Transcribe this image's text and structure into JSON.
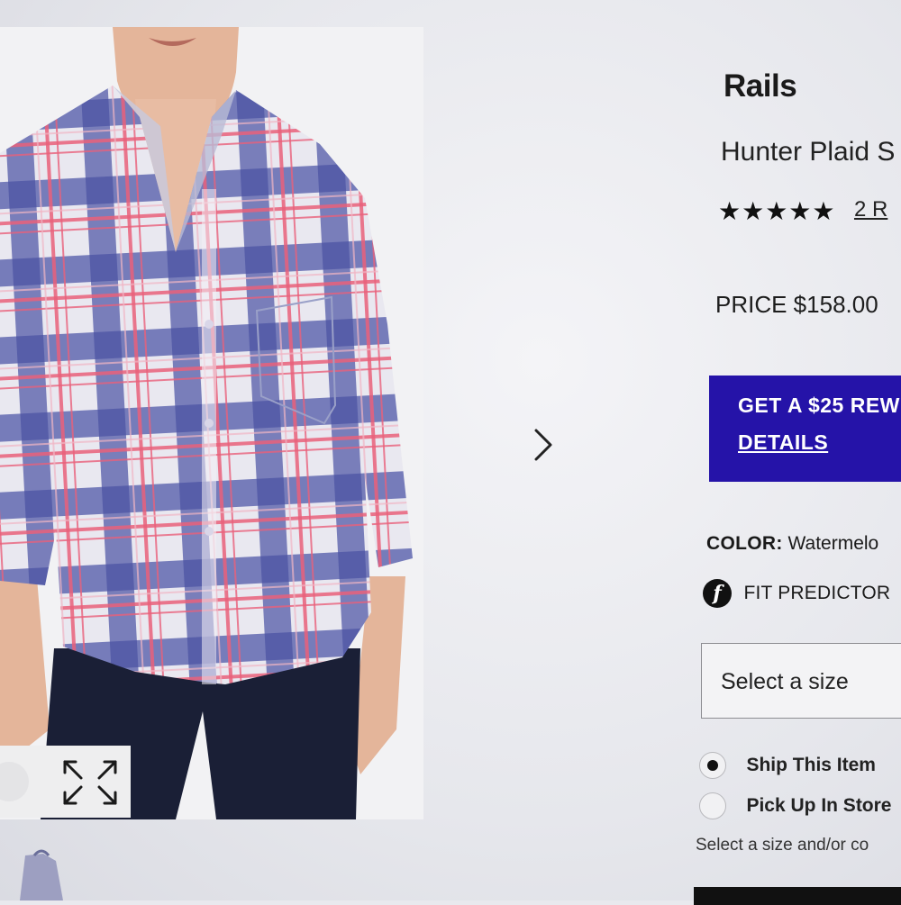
{
  "product": {
    "brand": "Rails",
    "name": "Hunter Plaid S",
    "stars": "★★★★★",
    "reviews": "2 R",
    "price": "PRICE $158.00"
  },
  "reward": {
    "title": "GET A $25 REW",
    "details": "DETAILS"
  },
  "color": {
    "label": "COLOR:",
    "value": "Watermelo"
  },
  "fit_predictor": {
    "icon_glyph": "f",
    "label": "FIT PREDICTOR"
  },
  "size_select": {
    "label": "Select a size"
  },
  "fulfillment": {
    "options": [
      {
        "label": "Ship This Item",
        "selected": true
      },
      {
        "label": "Pick Up In Store",
        "selected": false
      }
    ],
    "hint": "Select a size and/or co"
  },
  "colors": {
    "accent": "#2513a8",
    "text": "#1a1a1a"
  },
  "icons": {
    "next": "chevron-right-icon",
    "zoom": "expand-icon",
    "rating": "star-icon"
  }
}
